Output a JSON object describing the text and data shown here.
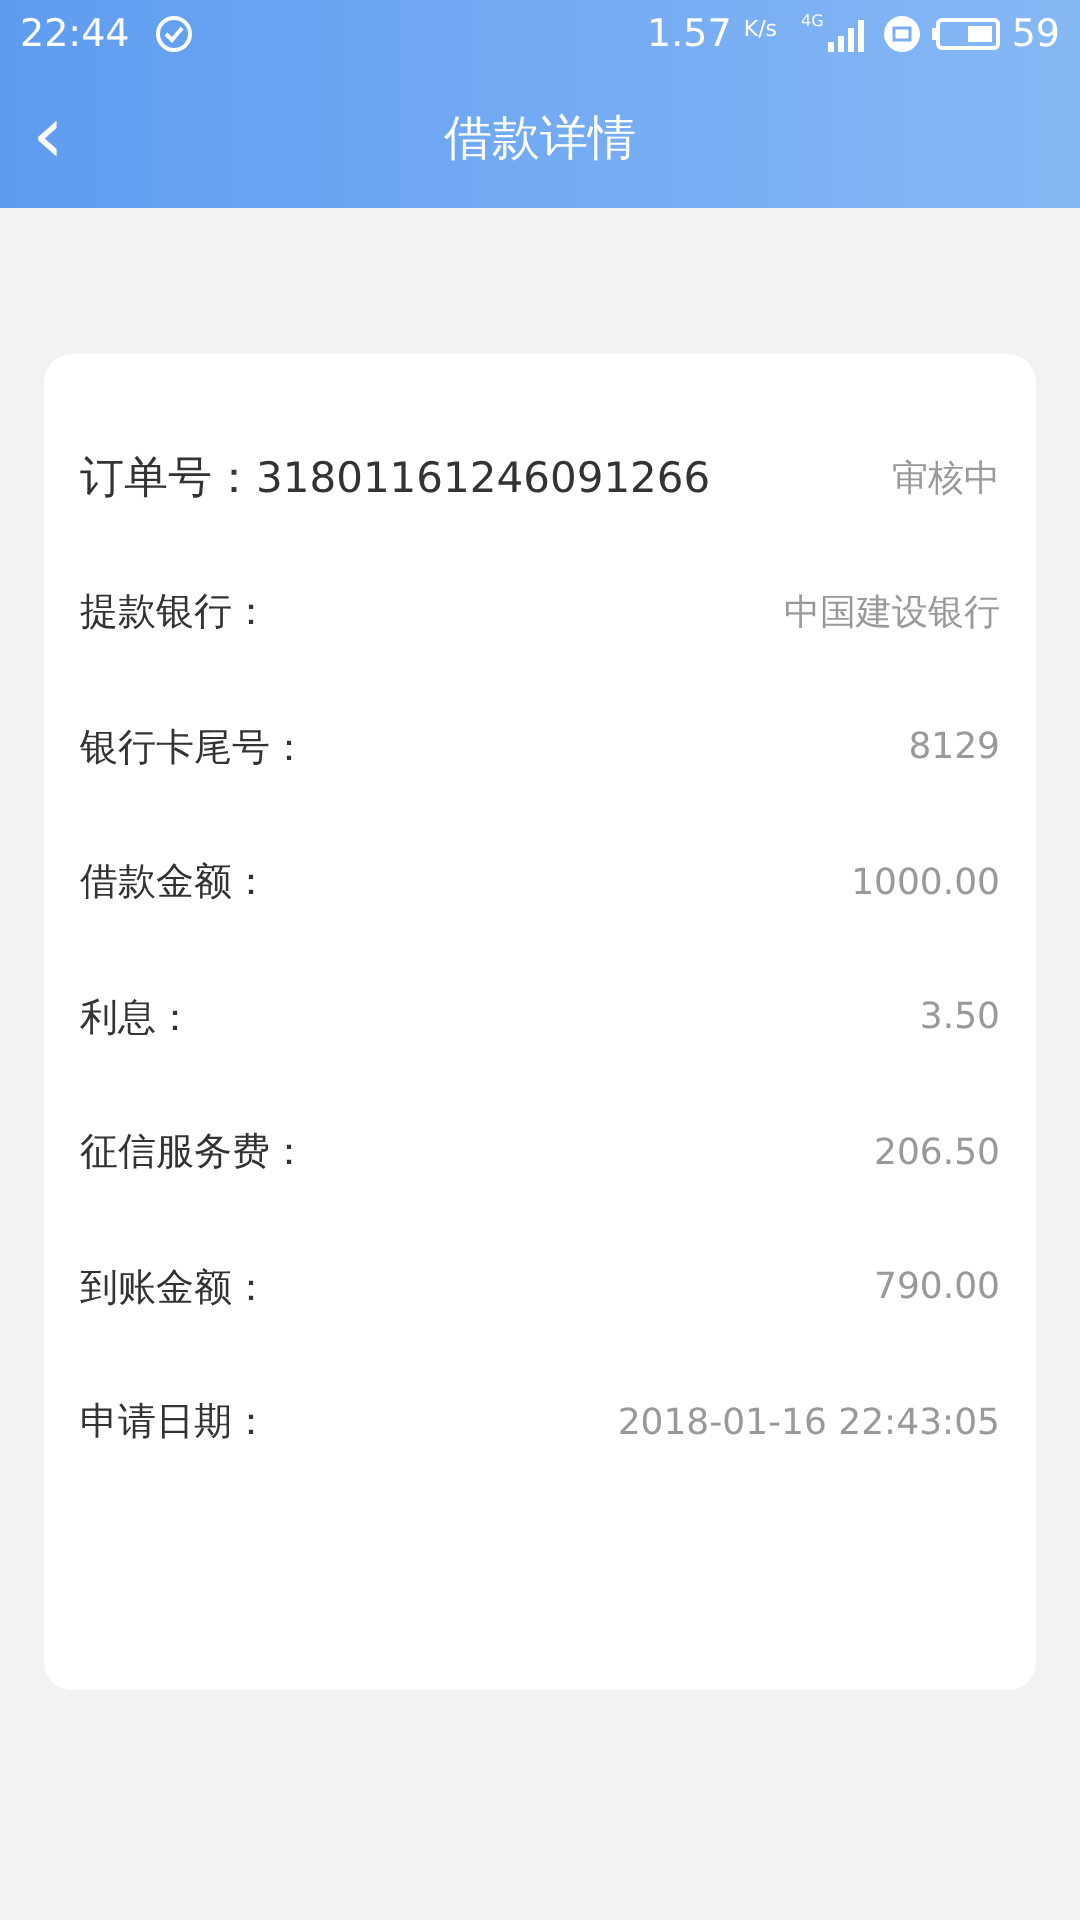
{
  "status_bar": {
    "time": "22:44",
    "speed": "1.57",
    "speed_unit": "K/s",
    "network": "4G",
    "battery": "59"
  },
  "header": {
    "back": "‹",
    "title": "借款详情"
  },
  "order": {
    "label": "订单号：",
    "number": "31801161246091266",
    "status": "审核中"
  },
  "rows": [
    {
      "label": "提款银行：",
      "value": "中国建设银行"
    },
    {
      "label": "银行卡尾号：",
      "value": "8129"
    },
    {
      "label": "借款金额：",
      "value": "1000.00"
    },
    {
      "label": "利息：",
      "value": "3.50"
    },
    {
      "label": "征信服务费：",
      "value": "206.50"
    },
    {
      "label": "到账金额：",
      "value": "790.00"
    },
    {
      "label": "申请日期：",
      "value": "2018-01-16 22:43:05"
    }
  ]
}
